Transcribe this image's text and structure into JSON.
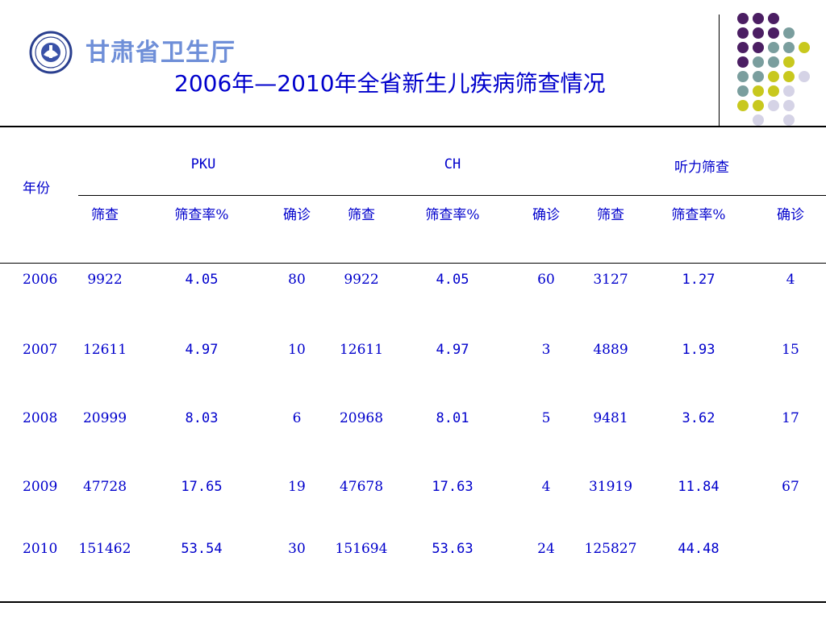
{
  "header": {
    "org_name": "甘肃省卫生厅",
    "title": "2006年—2010年全省新生儿疾病筛查情况"
  },
  "colors": {
    "text": "#0000cc",
    "purple": "#4b1e63",
    "teal": "#7a9e9e",
    "yellow": "#c8c81e",
    "lavender": "#d5d3e6"
  },
  "table": {
    "year_header": "年份",
    "groups": [
      "PKU",
      "CH",
      "听力筛查"
    ],
    "subheaders": [
      "筛查",
      "筛查率%",
      "确诊",
      "筛查",
      "筛查率%",
      "确诊",
      "筛查",
      "筛查率%",
      "确诊"
    ],
    "rows": [
      {
        "year": "2006",
        "cells": [
          "9922",
          "4.05",
          "80",
          "9922",
          "4.05",
          "60",
          "3127",
          "1.27",
          "4"
        ]
      },
      {
        "year": "2007",
        "cells": [
          "12611",
          "4.97",
          "10",
          "12611",
          "4.97",
          "3",
          "4889",
          "1.93",
          "15"
        ]
      },
      {
        "year": "2008",
        "cells": [
          "20999",
          "8.03",
          "6",
          "20968",
          "8.01",
          "5",
          "9481",
          "3.62",
          "17"
        ]
      },
      {
        "year": "2009",
        "cells": [
          "47728",
          "17.65",
          "19",
          "47678",
          "17.63",
          "4",
          "31919",
          "11.84",
          "67"
        ]
      },
      {
        "year": "2010",
        "cells": [
          "151462",
          "53.54",
          "30",
          "151694",
          "53.63",
          "24",
          "125827",
          "44.48",
          ""
        ]
      }
    ]
  }
}
